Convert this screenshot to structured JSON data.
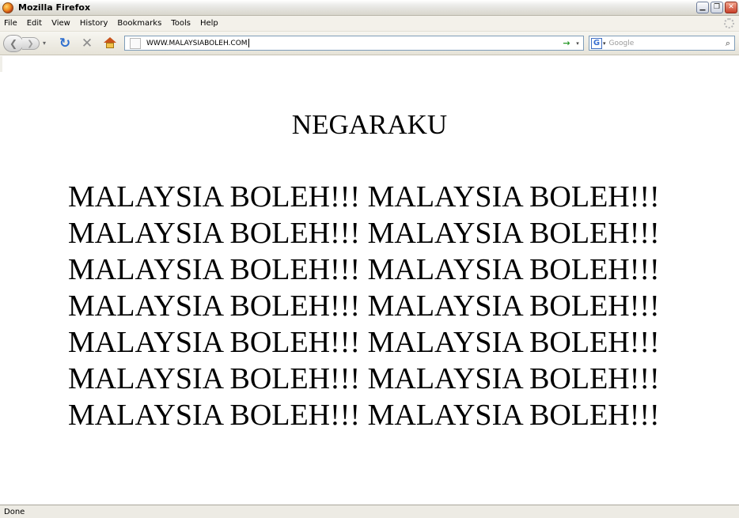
{
  "window": {
    "title": "Mozilla Firefox",
    "controls": [
      "minimize",
      "restore",
      "close"
    ]
  },
  "menubar": {
    "items": [
      {
        "label": "File"
      },
      {
        "label": "Edit"
      },
      {
        "label": "View"
      },
      {
        "label": "History"
      },
      {
        "label": "Bookmarks"
      },
      {
        "label": "Tools"
      },
      {
        "label": "Help"
      }
    ]
  },
  "toolbar": {
    "url": "WWW.MALAYSIABOLEH.COM",
    "search_engine_letter": "G",
    "search_placeholder": "Google",
    "icons": [
      "back-icon",
      "forward-icon",
      "history-dropdown-icon",
      "reload-icon",
      "stop-icon",
      "home-icon",
      "site-icon",
      "go-icon",
      "search-icon"
    ]
  },
  "page": {
    "heading": "NEGARAKU",
    "lines": [
      "MALAYSIA BOLEH!!! MALAYSIA BOLEH!!!",
      "MALAYSIA BOLEH!!! MALAYSIA BOLEH!!!",
      "MALAYSIA BOLEH!!! MALAYSIA BOLEH!!!",
      "MALAYSIA BOLEH!!! MALAYSIA BOLEH!!!",
      "MALAYSIA BOLEH!!! MALAYSIA BOLEH!!!",
      "MALAYSIA BOLEH!!! MALAYSIA BOLEH!!!",
      "MALAYSIA BOLEH!!! MALAYSIA BOLEH!!!"
    ]
  },
  "status": {
    "text": "Done"
  }
}
